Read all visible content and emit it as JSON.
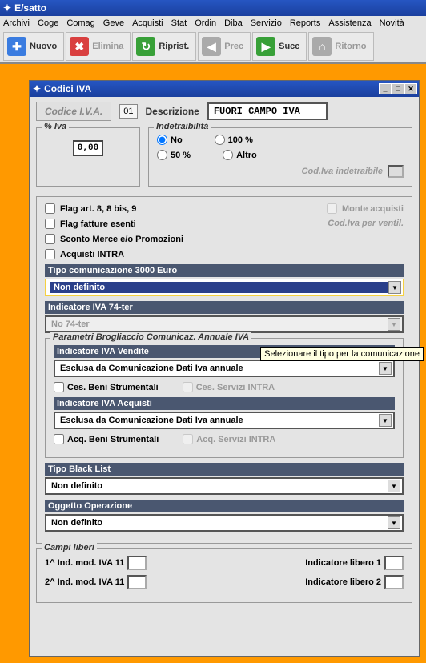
{
  "app": {
    "title": "E/satto"
  },
  "menu": [
    "Archivi",
    "Coge",
    "Comag",
    "Geve",
    "Acquisti",
    "Stat",
    "Ordin",
    "Diba",
    "Servizio",
    "Reports",
    "Assistenza",
    "Novità"
  ],
  "toolbar": {
    "nuovo": "Nuovo",
    "elimina": "Elimina",
    "riprist": "Riprist.",
    "prec": "Prec",
    "succ": "Succ",
    "ritorno": "Ritorno"
  },
  "child": {
    "title": "Codici IVA",
    "codice_btn": "Codice I.V.A.",
    "codice_val": "01",
    "descrizione_label": "Descrizione",
    "descrizione_val": "FUORI CAMPO IVA"
  },
  "perc_iva": {
    "legend": "% Iva",
    "value": "0,00"
  },
  "indet": {
    "legend": "Indetraibilità",
    "no": "No",
    "p100": "100 %",
    "p50": "50 %",
    "altro": "Altro",
    "cod_label": "Cod.Iva indetraibile"
  },
  "flags": {
    "art8": "Flag art. 8, 8 bis, 9",
    "monte": "Monte acquisti",
    "fatture": "Flag fatture esenti",
    "ventil": "Cod.Iva per ventil.",
    "sconto": "Sconto Merce e/o Promozioni",
    "acquisti": "Acquisti INTRA"
  },
  "tipo3000": {
    "header": "Tipo comunicazione 3000 Euro",
    "value": "Non definito",
    "tooltip": "Selezionare il tipo per la comunicazione"
  },
  "iva74": {
    "header": "Indicatore IVA 74-ter",
    "value": "No 74-ter"
  },
  "brog": {
    "legend": "Parametri Brogliaccio Comunicaz. Annuale IVA",
    "vendite_h": "Indicatore IVA Vendite",
    "vendite_v": "Esclusa da Comunicazione Dati Iva annuale",
    "ces_beni": "Ces. Beni Strumentali",
    "ces_serv": "Ces. Servizi INTRA",
    "acq_h": "Indicatore IVA Acquisti",
    "acq_v": "Esclusa da Comunicazione Dati Iva annuale",
    "acq_beni": "Acq. Beni Strumentali",
    "acq_serv": "Acq. Servizi INTRA"
  },
  "blacklist": {
    "header": "Tipo Black List",
    "value": "Non definito"
  },
  "oggetto": {
    "header": "Oggetto Operazione",
    "value": "Non definito"
  },
  "campi": {
    "legend": "Campi liberi",
    "ind1": "1^ Ind. mod. IVA 11",
    "ind2": "2^ Ind. mod. IVA 11",
    "lib1": "Indicatore libero 1",
    "lib2": "Indicatore libero 2"
  }
}
